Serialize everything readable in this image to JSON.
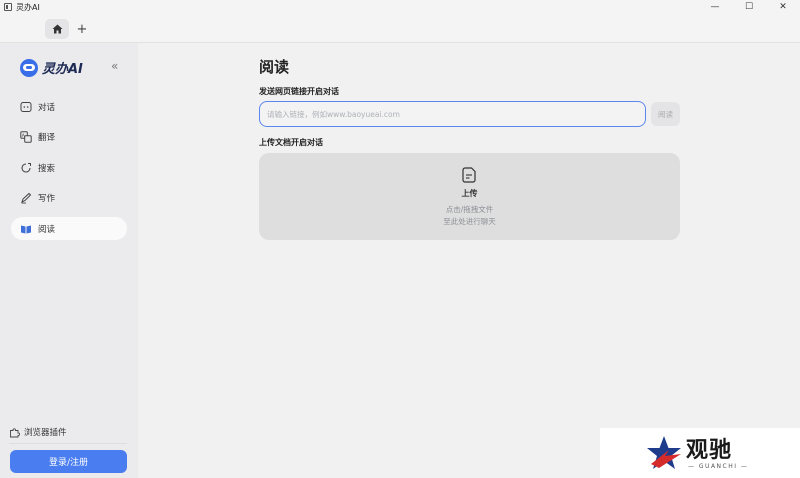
{
  "window": {
    "title": "灵办AI",
    "controls": {
      "minimize": "—",
      "maximize": "☐",
      "close": "✕"
    }
  },
  "tabbar": {
    "home_icon": "home-icon",
    "new_tab": "+"
  },
  "sidebar": {
    "brand": "灵办AI",
    "collapse": "«",
    "items": [
      {
        "label": "对话",
        "icon": "chat-icon",
        "active": false
      },
      {
        "label": "翻译",
        "icon": "translate-icon",
        "active": false
      },
      {
        "label": "搜索",
        "icon": "search-icon",
        "active": false
      },
      {
        "label": "写作",
        "icon": "pen-icon",
        "active": false
      },
      {
        "label": "阅读",
        "icon": "book-icon",
        "active": true
      }
    ],
    "plugin": "浏览器插件",
    "login": "登录/注册"
  },
  "main": {
    "title": "阅读",
    "link_section": "发送网页链接开启对话",
    "url_input": {
      "value": "",
      "placeholder": "请输入链接，例如www.baoyueai.com"
    },
    "read_button": "阅读",
    "upload_section": "上传文档开启对话",
    "upload": {
      "title": "上传",
      "hint1": "点击/拖拽文件",
      "hint2": "至此处进行聊天"
    }
  },
  "watermark": {
    "text": "观驰",
    "sub": "— GUANCHI —"
  },
  "colors": {
    "accent": "#4a7df0",
    "sidebar_bg": "#ebebed",
    "main_bg": "#f1f1f2"
  }
}
